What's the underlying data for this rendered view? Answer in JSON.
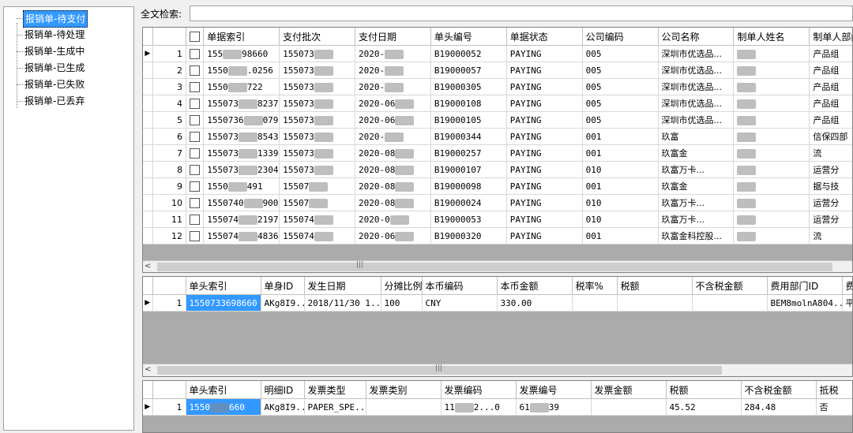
{
  "tree": {
    "items": [
      {
        "label": "报销单-待支付",
        "selected": true
      },
      {
        "label": "报销单-待处理",
        "selected": false
      },
      {
        "label": "报销单-生成中",
        "selected": false
      },
      {
        "label": "报销单-已生成",
        "selected": false
      },
      {
        "label": "报销单-已失败",
        "selected": false
      },
      {
        "label": "报销单-已丢弃",
        "selected": false
      }
    ]
  },
  "search": {
    "label": "全文检索:",
    "value": ""
  },
  "main_grid": {
    "columns": [
      "单据索引",
      "支付批次",
      "支付日期",
      "单头编号",
      "单据状态",
      "公司编码",
      "公司名称",
      "制单人姓名",
      "制单人部门称"
    ],
    "rows": [
      {
        "n": "1",
        "idx_a": "155",
        "idx_b": "98660",
        "batch": "155073",
        "date": "2020-",
        "head": "B19000052",
        "status": "PAYING",
        "code": "005",
        "company": "深圳市优选品...",
        "dept": "产品组"
      },
      {
        "n": "2",
        "idx_a": "1550",
        "idx_b": ".0256",
        "batch": "155073",
        "date": "2020-",
        "head": "B19000057",
        "status": "PAYING",
        "code": "005",
        "company": "深圳市优选品...",
        "dept": "产品组"
      },
      {
        "n": "3",
        "idx_a": "1550",
        "idx_b": "722",
        "batch": "155073",
        "date": "2020-",
        "head": "B19000305",
        "status": "PAYING",
        "code": "005",
        "company": "深圳市优选品...",
        "dept": "产品组"
      },
      {
        "n": "4",
        "idx_a": "155073",
        "idx_b": "8237",
        "batch": "155073",
        "date": "2020-06",
        "head": "B19000108",
        "status": "PAYING",
        "code": "005",
        "company": "深圳市优选品...",
        "dept": "产品组"
      },
      {
        "n": "5",
        "idx_a": "1550736",
        "idx_b": "0790",
        "batch": "155073",
        "date": "2020-06",
        "head": "B19000105",
        "status": "PAYING",
        "code": "005",
        "company": "深圳市优选品...",
        "dept": "产品组"
      },
      {
        "n": "6",
        "idx_a": "155073",
        "idx_b": "8543",
        "batch": "155073",
        "date": "2020-",
        "head": "B19000344",
        "status": "PAYING",
        "code": "001",
        "company": "玖富",
        "dept": "信保四部"
      },
      {
        "n": "7",
        "idx_a": "155073",
        "idx_b": "1339",
        "batch": "155073",
        "date": "2020-08",
        "head": "B19000257",
        "status": "PAYING",
        "code": "001",
        "company": "玖富金",
        "dept": "流"
      },
      {
        "n": "8",
        "idx_a": "155073",
        "idx_b": "2304",
        "batch": "155073",
        "date": "2020-08",
        "head": "B19000107",
        "status": "PAYING",
        "code": "010",
        "company": "玖富万卡...",
        "dept": "运营分"
      },
      {
        "n": "9",
        "idx_a": "1550",
        "idx_b": "491",
        "batch": "15507",
        "date": "2020-08",
        "head": "B19000098",
        "status": "PAYING",
        "code": "001",
        "company": "玖富金",
        "dept": "据与技"
      },
      {
        "n": "10",
        "idx_a": "1550740",
        "idx_b": "9000",
        "batch": "15507",
        "date": "2020-08",
        "head": "B19000024",
        "status": "PAYING",
        "code": "010",
        "company": "玖富万卡...",
        "dept": "运营分"
      },
      {
        "n": "11",
        "idx_a": "155074",
        "idx_b": "2197",
        "batch": "155074",
        "date": "2020-0",
        "head": "B19000053",
        "status": "PAYING",
        "code": "010",
        "company": "玖富万卡...",
        "dept": "运营分"
      },
      {
        "n": "12",
        "idx_a": "155074",
        "idx_b": "4836",
        "batch": "155074",
        "date": "2020-06",
        "head": "B19000320",
        "status": "PAYING",
        "code": "001",
        "company": "玖富金科控股...",
        "dept": "流"
      }
    ]
  },
  "detail_grid": {
    "columns": [
      "单头索引",
      "单身ID",
      "发生日期",
      "分摊比例",
      "本币编码",
      "本币金额",
      "税率%",
      "税额",
      "不含税金额",
      "费用部门ID",
      "费"
    ],
    "rows": [
      {
        "n": "1",
        "head_idx": "1550733698660",
        "body_id": "AKg8I9...",
        "date": "2018/11/30 1...",
        "ratio": "100",
        "currency": "CNY",
        "amount": "330.00",
        "rate": "",
        "tax": "",
        "net": "",
        "dept_id": "BEM8molnA804...",
        "fee": "平"
      }
    ]
  },
  "invoice_grid": {
    "columns": [
      "单头索引",
      "明细ID",
      "发票类型",
      "发票类别",
      "发票编码",
      "发票编号",
      "发票金额",
      "税额",
      "不含税金额",
      "抵税"
    ],
    "rows": [
      {
        "n": "1",
        "head_idx_a": "1550",
        "head_idx_b": "660",
        "detail_id": "AKg8I9...",
        "type": "PAPER_SPE...",
        "category": "",
        "code_a": "11",
        "code_b": "2...0",
        "no_a": "61",
        "no_b": "39",
        "amount": "",
        "tax": "45.52",
        "net": "284.48",
        "deduct": "否"
      }
    ]
  }
}
